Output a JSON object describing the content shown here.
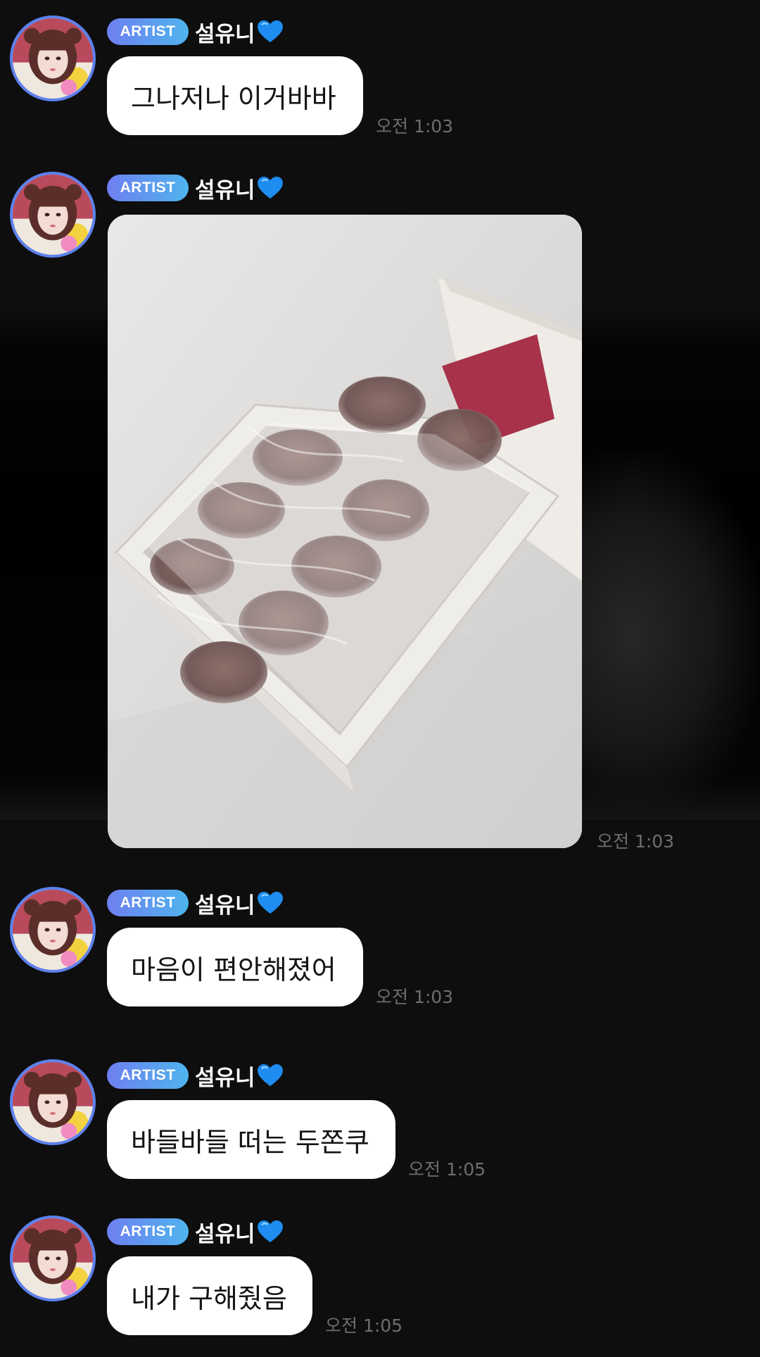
{
  "messages": [
    {
      "badge": "ARTIST",
      "sender": "설유니",
      "heart_icon": "blue-heart-icon",
      "text": "그나저나 이거바바",
      "time": "오전 1:03"
    },
    {
      "badge": "ARTIST",
      "sender": "설유니",
      "heart_icon": "blue-heart-icon",
      "type": "image",
      "time": "오전 1:03"
    },
    {
      "badge": "ARTIST",
      "sender": "설유니",
      "heart_icon": "blue-heart-icon",
      "text": "마음이 편안해졌어",
      "time": "오전 1:03"
    },
    {
      "badge": "ARTIST",
      "sender": "설유니",
      "heart_icon": "blue-heart-icon",
      "text": "바들바들 떠는 두쫀쿠",
      "time": "오전 1:05"
    },
    {
      "badge": "ARTIST",
      "sender": "설유니",
      "heart_icon": "blue-heart-icon",
      "text": "내가 구해줬음",
      "time": "오전 1:05"
    }
  ],
  "colors": {
    "background": "#0e0e0f",
    "avatar_ring": "#5d82ee",
    "badge_gradient_start": "#6e7ff0",
    "badge_gradient_end": "#4fb4ee",
    "bubble": "#ffffff",
    "timestamp": "#6d6e71",
    "heart": "#1e8cf0"
  }
}
